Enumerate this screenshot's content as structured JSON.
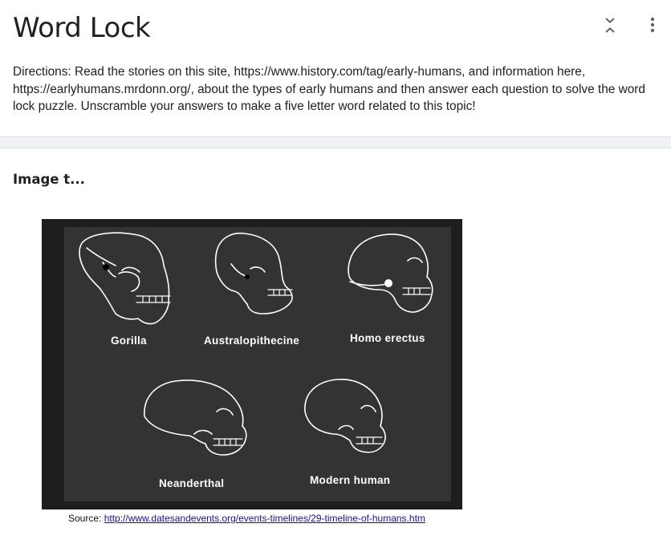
{
  "header": {
    "title": "Word Lock",
    "directions": "Directions: Read the stories on this site, https://www.history.com/tag/early-humans, and information here, https://earlyhumans.mrdonn.org/, about the types of early humans and then answer each question to solve the word lock puzzle. Unscramble your answers to make a five letter word related to this topic!",
    "collapse_icon": "collapse-arrows-icon",
    "menu_icon": "more-vert-icon"
  },
  "image_item": {
    "title": "Image t...",
    "skull_labels": {
      "gorilla": "Gorilla",
      "australopithecine": "Australopithecine",
      "homo_erectus": "Homo erectus",
      "neanderthal": "Neanderthal",
      "modern_human": "Modern human"
    },
    "source_prefix": "Source: ",
    "source_link": "http://www.datesandevents.org/events-timelines/29-timeline-of-humans.htm"
  },
  "colors": {
    "figure_background": "#333333",
    "figure_frame": "#1e1e1e",
    "link": "#1a0dab",
    "separator": "#f1f3f4"
  }
}
